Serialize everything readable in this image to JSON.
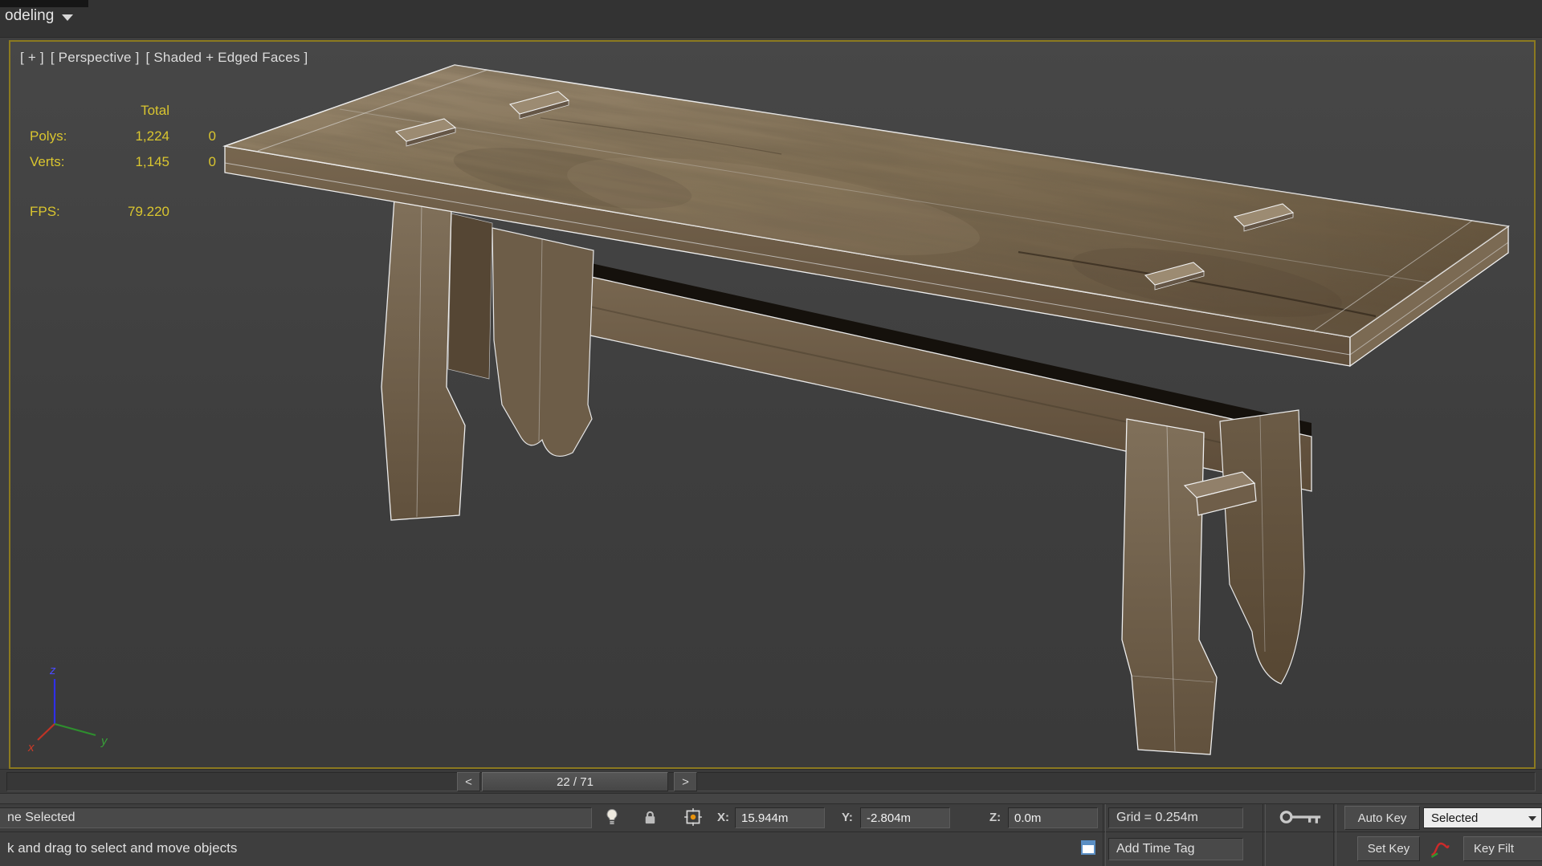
{
  "ribbon": {
    "tab_label": "odeling"
  },
  "viewport": {
    "menus": {
      "plus": "[ + ]",
      "view": "[ Perspective ]",
      "shading": "[ Shaded + Edged Faces ]"
    },
    "stats": {
      "header": "Total",
      "rows": [
        {
          "label": "Polys:",
          "total": "1,224",
          "selected": "0"
        },
        {
          "label": "Verts:",
          "total": "1,145",
          "selected": "0"
        }
      ],
      "fps_label": "FPS:",
      "fps_value": "79.220"
    },
    "axis": {
      "x": "x",
      "y": "y",
      "z": "z"
    }
  },
  "timeline": {
    "prev": "<",
    "frame": "22 / 71",
    "next": ">"
  },
  "status": {
    "selection": "ne Selected",
    "prompt": "k and drag to select and move objects",
    "coords": [
      {
        "label": "X:",
        "value": "15.944m"
      },
      {
        "label": "Y:",
        "value": "-2.804m"
      },
      {
        "label": "Z:",
        "value": "0.0m"
      }
    ],
    "grid": "Grid = 0.254m",
    "add_time_tag": "Add Time Tag",
    "keying": {
      "auto_key": "Auto Key",
      "set_key": "Set Key",
      "key_filters": "Key Filt",
      "filter_set": "Selected"
    }
  },
  "colors": {
    "viewport_border": "#8c7a20",
    "stats_text": "#d9c52f",
    "axis_x": "#c03325",
    "axis_y": "#2e8f2e",
    "axis_z": "#2f2fe8",
    "wood_top": "#857459"
  }
}
